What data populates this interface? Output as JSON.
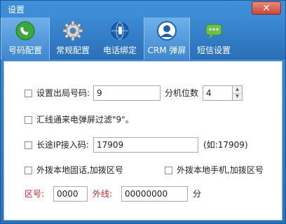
{
  "window": {
    "title": "设置",
    "close_glyph": "✕"
  },
  "tabs": [
    {
      "label": "号码配置",
      "icon": "phone-sync-icon",
      "active": true
    },
    {
      "label": "常规配置",
      "icon": "gear-icon",
      "active": false
    },
    {
      "label": "电话绑定",
      "icon": "globe-phone-icon",
      "active": false
    },
    {
      "label": "CRM 弹屏",
      "icon": "crm-user-icon",
      "active": true
    },
    {
      "label": "短信设置",
      "icon": "sms-icon",
      "active": false
    }
  ],
  "form": {
    "outbound_prefix_label": "设置出局号码:",
    "outbound_prefix_value": "9",
    "ext_digits_label": "分机位数",
    "ext_digits_value": "4",
    "filter_label": "汇线通来电弹屏过滤\"9\"。",
    "ipcode_label": "长途IP接入码:",
    "ipcode_value": "17909",
    "ipcode_hint": "(如:17909)",
    "local_landline_label": "外拨本地固话,加拨区号",
    "local_mobile_label": "外拨本地手机,加拨区号",
    "area_code_label": "区号:",
    "area_code_value": "0000",
    "outside_label": "外线:",
    "outside_value": "00000000",
    "unit_label": "分"
  },
  "colors": {
    "accent": "#2c72bb",
    "red_label": "#c62828"
  }
}
